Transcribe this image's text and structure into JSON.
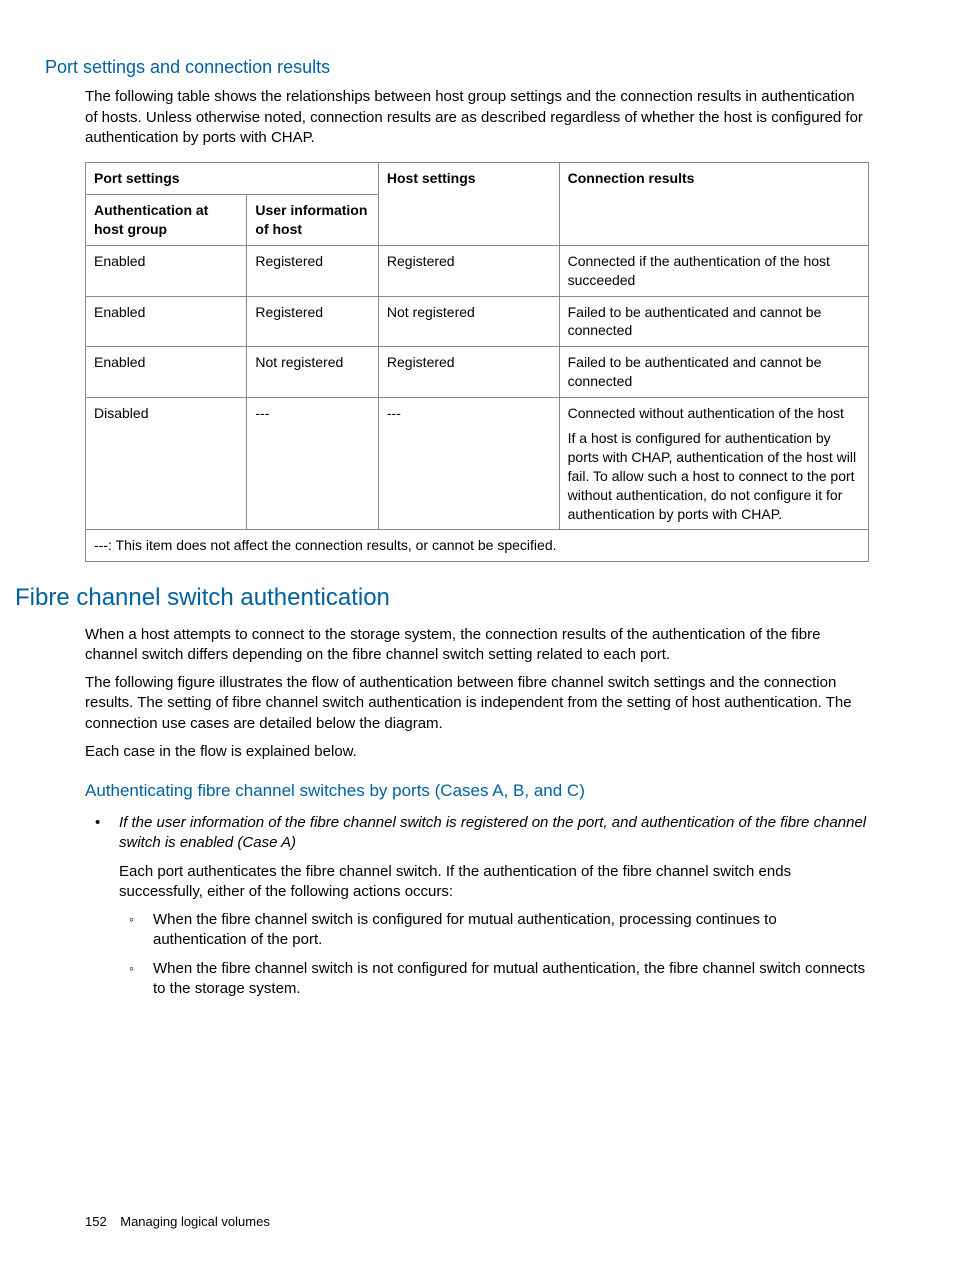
{
  "section1": {
    "title": "Port settings and connection results",
    "intro": "The following table shows the relationships between host group settings and the connection results in authentication of hosts. Unless otherwise noted, connection results are as described regardless of whether the host is configured for authentication by ports with CHAP."
  },
  "table": {
    "headers": {
      "port_settings": "Port settings",
      "auth_at_host_group": "Authentication at host group",
      "user_info_of_host": "User information of host",
      "host_settings": "Host settings",
      "connection_results": "Connection results"
    },
    "rows": [
      {
        "auth": "Enabled",
        "userinfo": "Registered",
        "host": "Registered",
        "result": "Connected if the authentication of the host succeeded"
      },
      {
        "auth": "Enabled",
        "userinfo": "Registered",
        "host": "Not registered",
        "result": "Failed to be authenticated and cannot be connected"
      },
      {
        "auth": "Enabled",
        "userinfo": "Not registered",
        "host": "Registered",
        "result": "Failed to be authenticated and cannot be connected"
      },
      {
        "auth": "Disabled",
        "userinfo": "---",
        "host": "---",
        "result": "Connected without authentication of the host",
        "result_extra": "If a host is configured for authentication by ports with CHAP, authentication of the host will fail. To allow such a host to connect to the port without authentication, do not configure it for authentication by ports with CHAP."
      }
    ],
    "footnote": "---: This item does not affect the connection results, or cannot be specified."
  },
  "section2": {
    "title": "Fibre channel switch authentication",
    "p1": "When a host attempts to connect to the storage system, the connection results of the authentication of the fibre channel switch differs depending on the fibre channel switch setting related to each port.",
    "p2": "The following figure illustrates the flow of authentication between fibre channel switch settings and the connection results. The setting of fibre channel switch authentication is independent from the setting of host authentication. The connection use cases are detailed below the diagram.",
    "p3": "Each case in the flow is explained below.",
    "sub_title": "Authenticating fibre channel switches by ports (Cases A, B, and C)",
    "bullet1_title": "If the user information of the fibre channel switch is registered on the port, and authentication of the fibre channel switch is enabled (Case A)",
    "bullet1_body": "Each port authenticates the fibre channel switch. If the authentication of the fibre channel switch ends successfully, either of the following actions occurs:",
    "sub_bullets": [
      "When the fibre channel switch is configured for mutual authentication, processing continues to authentication of the port.",
      "When the fibre channel switch is not configured for mutual authentication, the fibre channel switch connects to the storage system."
    ]
  },
  "footer": {
    "page_number": "152",
    "chapter": "Managing logical volumes"
  }
}
